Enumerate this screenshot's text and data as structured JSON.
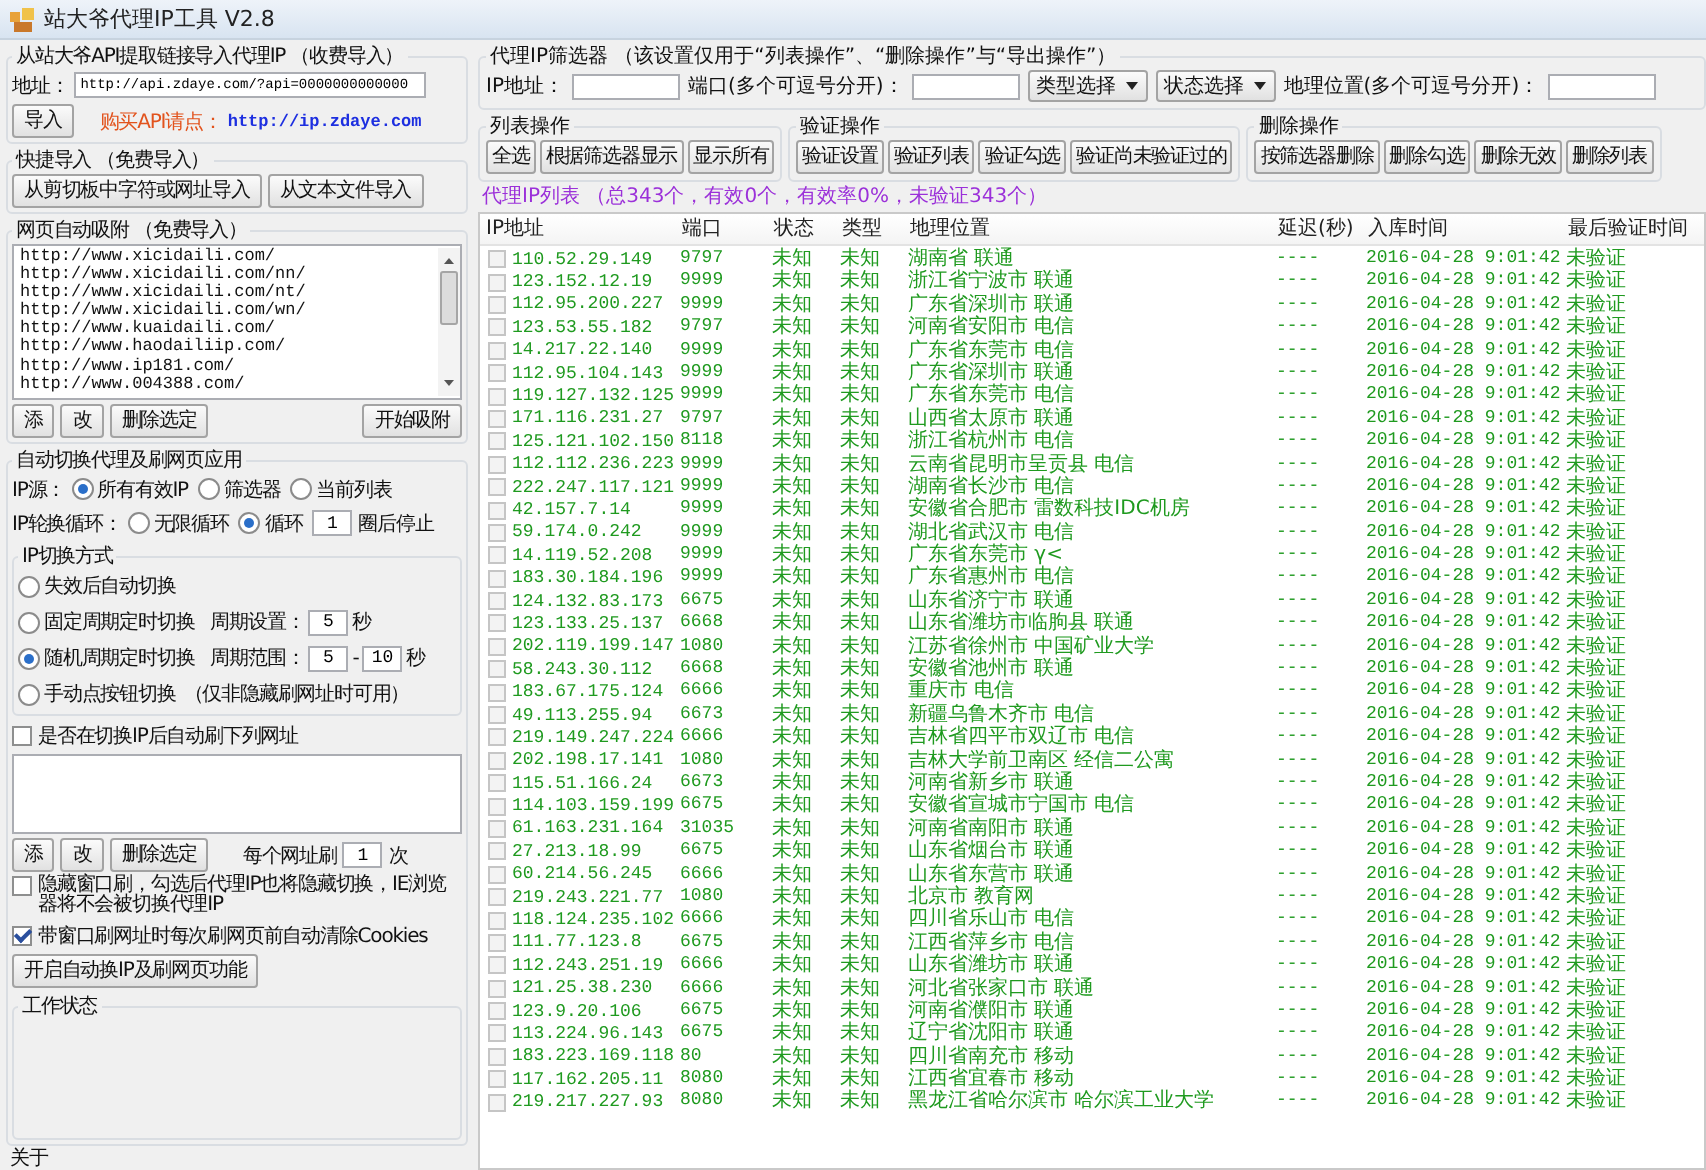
{
  "window": {
    "title": "站大爷代理IP工具 V2.8"
  },
  "api_import": {
    "title": "从站大爷API提取链接导入代理IP （收费导入）",
    "address_label": "地址：",
    "address_value": "http://api.zdaye.com/?api=0000000000000",
    "import_button": "导入",
    "buy_label": "购买API请点：",
    "buy_link": "http://ip.zdaye.com"
  },
  "quick_import": {
    "title": "快捷导入 （免费导入）",
    "buttons": [
      "从剪切板中字符或网址导入",
      "从文本文件导入"
    ]
  },
  "web_capture": {
    "title": "网页自动吸附 （免费导入）",
    "urls": [
      "http://www.xicidaili.com/",
      "http://www.xicidaili.com/nn/",
      "http://www.xicidaili.com/nt/",
      "http://www.xicidaili.com/wn/",
      "http://www.kuaidaili.com/",
      "http://www.haodailiip.com/",
      "http://www.ip181.com/",
      "http://www.004388.com/"
    ],
    "buttons": [
      "添",
      "改",
      "删除选定"
    ],
    "start_button": "开始吸附"
  },
  "auto_switch": {
    "title": "自动切换代理及刷网页应用",
    "ip_source": {
      "label": "IP源：",
      "options": [
        {
          "label": "所有有效IP",
          "selected": true
        },
        {
          "label": "筛选器",
          "selected": false
        },
        {
          "label": "当前列表",
          "selected": false
        }
      ]
    },
    "rotation": {
      "label": "IP轮换循环：",
      "options": [
        {
          "label": "无限循环",
          "selected": false
        },
        {
          "label": "循环",
          "selected": true
        }
      ],
      "count": "1",
      "suffix": "圈后停止"
    },
    "switch_mode": {
      "title": "IP切换方式",
      "options": [
        {
          "kind": "plain",
          "label": "失效后自动切换",
          "selected": false
        },
        {
          "kind": "fixed",
          "label": "固定周期定时切换",
          "selected": false,
          "setting_label": "周期设置：",
          "value": "5",
          "unit": "秒"
        },
        {
          "kind": "range",
          "label": "随机周期定时切换",
          "selected": true,
          "setting_label": "周期范围：",
          "from": "5",
          "separator": "-",
          "to": "10",
          "unit": "秒"
        },
        {
          "kind": "manual",
          "label": "手动点按钮切换",
          "selected": false,
          "note": "（仅非隐藏刷网址时可用）"
        }
      ]
    },
    "refresh_urls": {
      "label": "是否在切换IP后自动刷下列网址",
      "checked": false,
      "buttons": [
        "添",
        "改",
        "删除选定"
      ],
      "per_url_label": "每个网址刷",
      "per_url_count": "1",
      "per_url_unit": "次"
    },
    "hidden_refresh": {
      "label": "隐藏窗口刷，勾选后代理IP也将隐藏切换，IE浏览器将不会被切换代理IP",
      "checked": false
    },
    "clear_cookies": {
      "label": "带窗口刷网址时每次刷网页前自动清除Cookies",
      "checked": true
    },
    "start_button": "开启自动换IP及刷网页功能",
    "work_status": {
      "title": "工作状态"
    }
  },
  "about": {
    "title": "关于"
  },
  "filter": {
    "title": "代理IP筛选器 （该设置仅用于“列表操作”、“删除操作”与“导出操作”）",
    "ip_label": "IP地址：",
    "port_label": "端口(多个可逗号分开)：",
    "type_select": "类型选择",
    "status_select": "状态选择",
    "location_label": "地理位置(多个可逗号分开)："
  },
  "operation_groups": [
    {
      "title": "列表操作",
      "buttons": [
        "全选",
        "根据筛选器显示",
        "显示所有"
      ]
    },
    {
      "title": "验证操作",
      "buttons": [
        "验证设置",
        "验证列表",
        "验证勾选",
        "验证尚未验证过的"
      ]
    },
    {
      "title": "删除操作",
      "buttons": [
        "按筛选器删除",
        "删除勾选",
        "删除无效",
        "删除列表"
      ]
    }
  ],
  "list_summary": "代理IP列表 （总343个，有效0个，有效率0%，未验证343个）",
  "table": {
    "columns": [
      "IP地址",
      "端口",
      "状态",
      "类型",
      "地理位置",
      "延迟(秒)",
      "入库时间",
      "最后验证时间"
    ],
    "rows": [
      {
        "checked": false,
        "cells": [
          "110.52.29.149",
          "9797",
          "未知",
          "未知",
          "湖南省 联通",
          "----",
          "2016-04-28 9:01:42",
          "未验证"
        ]
      },
      {
        "checked": false,
        "cells": [
          "123.152.12.19",
          "9999",
          "未知",
          "未知",
          "浙江省宁波市 联通",
          "----",
          "2016-04-28 9:01:42",
          "未验证"
        ]
      },
      {
        "checked": false,
        "cells": [
          "112.95.200.227",
          "9999",
          "未知",
          "未知",
          "广东省深圳市 联通",
          "----",
          "2016-04-28 9:01:42",
          "未验证"
        ]
      },
      {
        "checked": false,
        "cells": [
          "123.53.55.182",
          "9797",
          "未知",
          "未知",
          "河南省安阳市 电信",
          "----",
          "2016-04-28 9:01:42",
          "未验证"
        ]
      },
      {
        "checked": false,
        "cells": [
          "14.217.22.140",
          "9999",
          "未知",
          "未知",
          "广东省东莞市 电信",
          "----",
          "2016-04-28 9:01:42",
          "未验证"
        ]
      },
      {
        "checked": false,
        "cells": [
          "112.95.104.143",
          "9999",
          "未知",
          "未知",
          "广东省深圳市 联通",
          "----",
          "2016-04-28 9:01:42",
          "未验证"
        ]
      },
      {
        "checked": false,
        "cells": [
          "119.127.132.125",
          "9999",
          "未知",
          "未知",
          "广东省东莞市 电信",
          "----",
          "2016-04-28 9:01:42",
          "未验证"
        ]
      },
      {
        "checked": false,
        "cells": [
          "171.116.231.27",
          "9797",
          "未知",
          "未知",
          "山西省太原市 联通",
          "----",
          "2016-04-28 9:01:42",
          "未验证"
        ]
      },
      {
        "checked": false,
        "cells": [
          "125.121.102.150",
          "8118",
          "未知",
          "未知",
          "浙江省杭州市 电信",
          "----",
          "2016-04-28 9:01:42",
          "未验证"
        ]
      },
      {
        "checked": false,
        "cells": [
          "112.112.236.223",
          "9999",
          "未知",
          "未知",
          "云南省昆明市呈贡县 电信",
          "----",
          "2016-04-28 9:01:42",
          "未验证"
        ]
      },
      {
        "checked": false,
        "cells": [
          "222.247.117.121",
          "9999",
          "未知",
          "未知",
          "湖南省长沙市 电信",
          "----",
          "2016-04-28 9:01:42",
          "未验证"
        ]
      },
      {
        "checked": false,
        "cells": [
          "42.157.7.14",
          "9999",
          "未知",
          "未知",
          "安徽省合肥市 雷数科技IDC机房",
          "----",
          "2016-04-28 9:01:42",
          "未验证"
        ]
      },
      {
        "checked": false,
        "cells": [
          "59.174.0.242",
          "9999",
          "未知",
          "未知",
          "湖北省武汉市 电信",
          "----",
          "2016-04-28 9:01:42",
          "未验证"
        ]
      },
      {
        "checked": false,
        "cells": [
          "14.119.52.208",
          "9999",
          "未知",
          "未知",
          "广东省东莞市 γ<",
          "----",
          "2016-04-28 9:01:42",
          "未验证"
        ]
      },
      {
        "checked": false,
        "cells": [
          "183.30.184.196",
          "9999",
          "未知",
          "未知",
          "广东省惠州市 电信",
          "----",
          "2016-04-28 9:01:42",
          "未验证"
        ]
      },
      {
        "checked": false,
        "cells": [
          "124.132.83.173",
          "6675",
          "未知",
          "未知",
          "山东省济宁市 联通",
          "----",
          "2016-04-28 9:01:42",
          "未验证"
        ]
      },
      {
        "checked": false,
        "cells": [
          "123.133.25.137",
          "6668",
          "未知",
          "未知",
          "山东省潍坊市临朐县 联通",
          "----",
          "2016-04-28 9:01:42",
          "未验证"
        ]
      },
      {
        "checked": false,
        "cells": [
          "202.119.199.147",
          "1080",
          "未知",
          "未知",
          "江苏省徐州市 中国矿业大学",
          "----",
          "2016-04-28 9:01:42",
          "未验证"
        ]
      },
      {
        "checked": false,
        "cells": [
          "58.243.30.112",
          "6668",
          "未知",
          "未知",
          "安徽省池州市 联通",
          "----",
          "2016-04-28 9:01:42",
          "未验证"
        ]
      },
      {
        "checked": false,
        "cells": [
          "183.67.175.124",
          "6666",
          "未知",
          "未知",
          "重庆市 电信",
          "----",
          "2016-04-28 9:01:42",
          "未验证"
        ]
      },
      {
        "checked": false,
        "cells": [
          "49.113.255.94",
          "6673",
          "未知",
          "未知",
          "新疆乌鲁木齐市 电信",
          "----",
          "2016-04-28 9:01:42",
          "未验证"
        ]
      },
      {
        "checked": false,
        "cells": [
          "219.149.247.224",
          "6666",
          "未知",
          "未知",
          "吉林省四平市双辽市 电信",
          "----",
          "2016-04-28 9:01:42",
          "未验证"
        ]
      },
      {
        "checked": false,
        "cells": [
          "202.198.17.141",
          "1080",
          "未知",
          "未知",
          "吉林大学前卫南区 经信二公寓",
          "----",
          "2016-04-28 9:01:42",
          "未验证"
        ]
      },
      {
        "checked": false,
        "cells": [
          "115.51.166.24",
          "6673",
          "未知",
          "未知",
          "河南省新乡市 联通",
          "----",
          "2016-04-28 9:01:42",
          "未验证"
        ]
      },
      {
        "checked": false,
        "cells": [
          "114.103.159.199",
          "6675",
          "未知",
          "未知",
          "安徽省宣城市宁国市 电信",
          "----",
          "2016-04-28 9:01:42",
          "未验证"
        ]
      },
      {
        "checked": false,
        "cells": [
          "61.163.231.164",
          "31035",
          "未知",
          "未知",
          "河南省南阳市 联通",
          "----",
          "2016-04-28 9:01:42",
          "未验证"
        ]
      },
      {
        "checked": false,
        "cells": [
          "27.213.18.99",
          "6675",
          "未知",
          "未知",
          "山东省烟台市 联通",
          "----",
          "2016-04-28 9:01:42",
          "未验证"
        ]
      },
      {
        "checked": false,
        "cells": [
          "60.214.56.245",
          "6666",
          "未知",
          "未知",
          "山东省东营市 联通",
          "----",
          "2016-04-28 9:01:42",
          "未验证"
        ]
      },
      {
        "checked": false,
        "cells": [
          "219.243.221.77",
          "1080",
          "未知",
          "未知",
          "北京市 教育网",
          "----",
          "2016-04-28 9:01:42",
          "未验证"
        ]
      },
      {
        "checked": false,
        "cells": [
          "118.124.235.102",
          "6666",
          "未知",
          "未知",
          "四川省乐山市 电信",
          "----",
          "2016-04-28 9:01:42",
          "未验证"
        ]
      },
      {
        "checked": false,
        "cells": [
          "111.77.123.8",
          "6675",
          "未知",
          "未知",
          "江西省萍乡市 电信",
          "----",
          "2016-04-28 9:01:42",
          "未验证"
        ]
      },
      {
        "checked": false,
        "cells": [
          "112.243.251.19",
          "6666",
          "未知",
          "未知",
          "山东省潍坊市 联通",
          "----",
          "2016-04-28 9:01:42",
          "未验证"
        ]
      },
      {
        "checked": false,
        "cells": [
          "121.25.38.230",
          "6666",
          "未知",
          "未知",
          "河北省张家口市 联通",
          "----",
          "2016-04-28 9:01:42",
          "未验证"
        ]
      },
      {
        "checked": false,
        "cells": [
          "123.9.20.106",
          "6675",
          "未知",
          "未知",
          "河南省濮阳市 联通",
          "----",
          "2016-04-28 9:01:42",
          "未验证"
        ]
      },
      {
        "checked": false,
        "cells": [
          "113.224.96.143",
          "6675",
          "未知",
          "未知",
          "辽宁省沈阳市 联通",
          "----",
          "2016-04-28 9:01:42",
          "未验证"
        ]
      },
      {
        "checked": false,
        "cells": [
          "183.223.169.118",
          "80",
          "未知",
          "未知",
          "四川省南充市 移动",
          "----",
          "2016-04-28 9:01:42",
          "未验证"
        ]
      },
      {
        "checked": false,
        "cells": [
          "117.162.205.11",
          "8080",
          "未知",
          "未知",
          "江西省宜春市 移动",
          "----",
          "2016-04-28 9:01:42",
          "未验证"
        ]
      },
      {
        "checked": false,
        "cells": [
          "219.217.227.93",
          "8080",
          "未知",
          "未知",
          "黑龙江省哈尔滨市 哈尔滨工业大学",
          "----",
          "2016-04-28 9:01:42",
          "未验证"
        ]
      }
    ]
  }
}
